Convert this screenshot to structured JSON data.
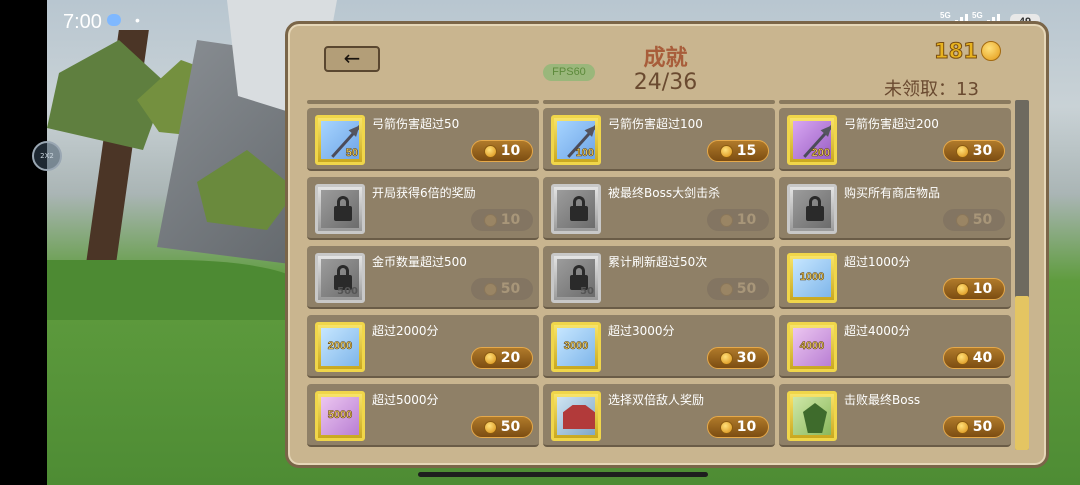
{
  "status_bar": {
    "time": "7:00",
    "dot": "•",
    "signal1_label": "5G",
    "signal2_label": "5G",
    "battery": "49"
  },
  "side_button": {
    "label": "2X2"
  },
  "header": {
    "back_symbol": "←",
    "fps": "FPS60",
    "title": "成就",
    "progress": "24/36",
    "coins": "181",
    "unclaimed": "未领取：13"
  },
  "achievements": [
    {
      "label": "弓箭伤害超过50",
      "icon": "arrow-icon",
      "icon_text": "50",
      "icon_bg": "blue",
      "reward": "10",
      "state": "claimable"
    },
    {
      "label": "弓箭伤害超过100",
      "icon": "arrow-icon",
      "icon_text": "100",
      "icon_bg": "blue",
      "reward": "15",
      "state": "claimable"
    },
    {
      "label": "弓箭伤害超过200",
      "icon": "arrow-icon",
      "icon_text": "200",
      "icon_bg": "purple",
      "reward": "30",
      "state": "claimable"
    },
    {
      "label": "开局获得6倍的奖励",
      "icon": "lock-icon",
      "icon_text": "",
      "icon_bg": "grey",
      "reward": "10",
      "state": "locked"
    },
    {
      "label": "被最终Boss大剑击杀",
      "icon": "lock-icon",
      "icon_text": "",
      "icon_bg": "grey",
      "reward": "10",
      "state": "locked"
    },
    {
      "label": "购买所有商店物品",
      "icon": "lock-icon",
      "icon_text": "",
      "icon_bg": "grey",
      "reward": "50",
      "state": "locked"
    },
    {
      "label": "金币数量超过500",
      "icon": "lock-icon",
      "icon_text": "500",
      "icon_bg": "grey",
      "reward": "50",
      "state": "locked"
    },
    {
      "label": "累计刷新超过50次",
      "icon": "lock-icon",
      "icon_text": "50",
      "icon_bg": "grey",
      "reward": "50",
      "state": "locked"
    },
    {
      "label": "超过1000分",
      "icon": "score-icon",
      "icon_text": "1000",
      "icon_bg": "lightblue",
      "reward": "10",
      "state": "claimable"
    },
    {
      "label": "超过2000分",
      "icon": "score-icon",
      "icon_text": "2000",
      "icon_bg": "lightblue",
      "reward": "20",
      "state": "claimable"
    },
    {
      "label": "超过3000分",
      "icon": "score-icon",
      "icon_text": "3000",
      "icon_bg": "lightblue",
      "reward": "30",
      "state": "claimable"
    },
    {
      "label": "超过4000分",
      "icon": "score-icon",
      "icon_text": "4000",
      "icon_bg": "lilac",
      "reward": "40",
      "state": "claimable"
    },
    {
      "label": "超过5000分",
      "icon": "score-icon",
      "icon_text": "5000",
      "icon_bg": "lilac",
      "reward": "50",
      "state": "claimable"
    },
    {
      "label": "选择双倍敌人奖励",
      "icon": "double-enemy-icon",
      "icon_text": "",
      "icon_bg": "double",
      "reward": "10",
      "state": "claimable"
    },
    {
      "label": "击败最终Boss",
      "icon": "boss-icon",
      "icon_text": "",
      "icon_bg": "boss",
      "reward": "50",
      "state": "claimable"
    }
  ],
  "colors": {
    "panel": "#c9b58f",
    "title": "#a85d3a",
    "coin_gold": "#e8b320",
    "reward_button": "#8a5818",
    "scroll_thumb": "#e4c562"
  }
}
